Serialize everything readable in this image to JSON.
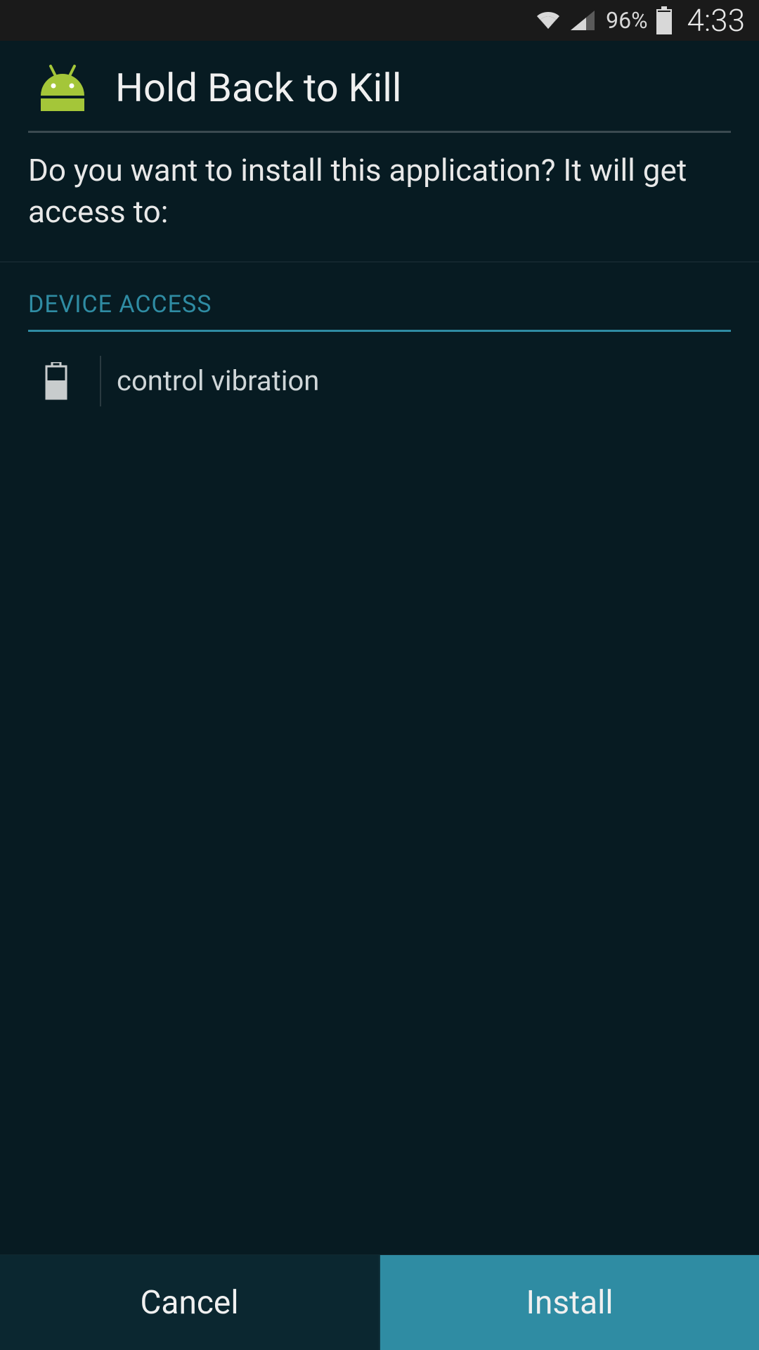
{
  "status": {
    "battery_pct": "96%",
    "clock": "4:33"
  },
  "header": {
    "title": "Hold Back to Kill"
  },
  "prompt": "Do you want to install this application? It will get access to:",
  "sections": [
    {
      "title": "DEVICE ACCESS",
      "permissions": [
        {
          "icon": "battery-icon",
          "label": "control vibration"
        }
      ]
    }
  ],
  "buttons": {
    "cancel": "Cancel",
    "install": "Install"
  }
}
